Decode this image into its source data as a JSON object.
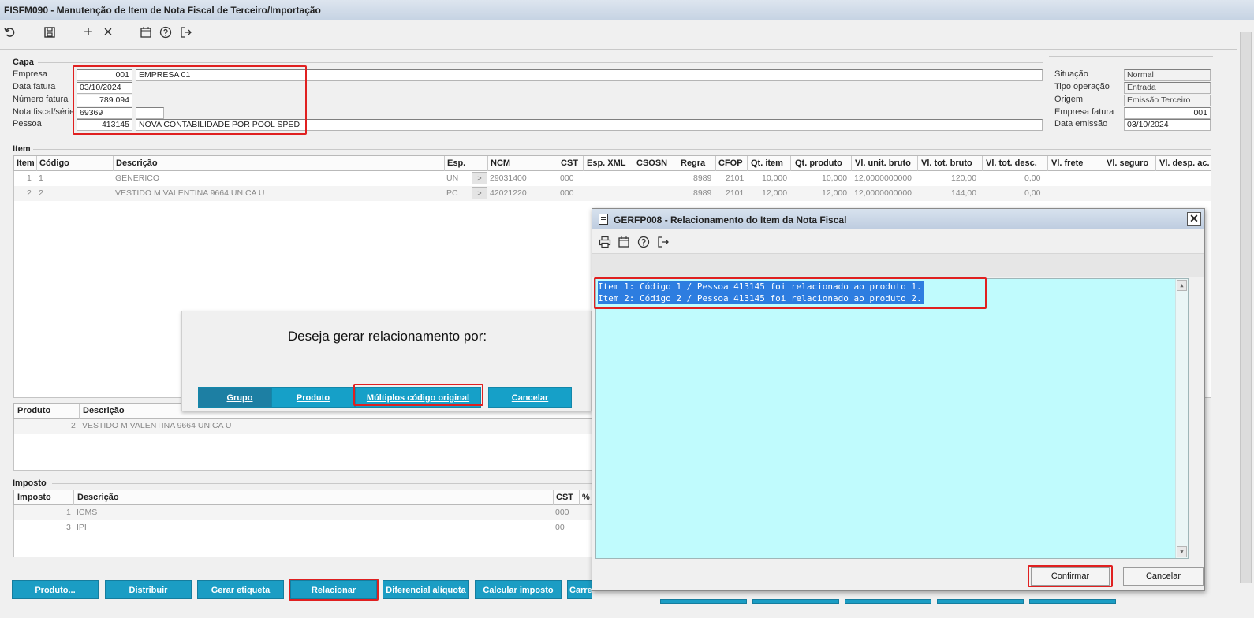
{
  "window": {
    "title": "FISFM090 - Manutenção de Item de Nota Fiscal de Terceiro/Importação"
  },
  "toolbar": {
    "icons": [
      "undo-icon",
      "save-icon",
      "add-icon",
      "delete-icon",
      "calendar-icon",
      "help-icon",
      "exit-icon"
    ],
    "add_glyph": "+",
    "delete_glyph": "×"
  },
  "capa": {
    "group_label": "Capa",
    "empresa_label": "Empresa",
    "empresa_code": "001",
    "empresa_name": "EMPRESA 01",
    "data_fatura_label": "Data fatura",
    "data_fatura": "03/10/2024",
    "numero_fatura_label": "Número fatura",
    "numero_fatura": "789.094",
    "nota_fiscal_label": "Nota fiscal/série",
    "nota_fiscal": "69369",
    "serie": "",
    "pessoa_label": "Pessoa",
    "pessoa_code": "413145",
    "pessoa_name": "NOVA CONTABILIDADE POR POOL SPED"
  },
  "side": {
    "situacao_label": "Situação",
    "situacao": "Normal",
    "tipo_operacao_label": "Tipo operação",
    "tipo_operacao": "Entrada",
    "origem_label": "Origem",
    "origem": "Emissão Terceiro",
    "empresa_fatura_label": "Empresa fatura",
    "empresa_fatura": "001",
    "data_emissao_label": "Data emissão",
    "data_emissao": "03/10/2024"
  },
  "item_grid": {
    "group_label": "Item",
    "columns": [
      "Item",
      "Código",
      "Descrição",
      "Esp.",
      "NCM",
      "CST",
      "Esp. XML",
      "CSOSN",
      "Regra",
      "CFOP",
      "Qt. item",
      "Qt. produto",
      "Vl. unit. bruto",
      "Vl. tot. bruto",
      "Vl. tot. desc.",
      "Vl. frete",
      "Vl. seguro",
      "Vl. desp. ac."
    ],
    "esp_button": ">",
    "rows": [
      {
        "item": "1",
        "codigo": "1",
        "descricao": "GENERICO",
        "esp": "UN",
        "ncm": "29031400",
        "cst": "000",
        "regra": "8989",
        "cfop": "2101",
        "qt_item": "10,000",
        "qt_produto": "10,000",
        "vl_unit": "12,0000000000",
        "vl_tot": "120,00",
        "vl_desc": "0,00"
      },
      {
        "item": "2",
        "codigo": "2",
        "descricao": "VESTIDO M VALENTINA 9664 UNICA U",
        "esp": "PC",
        "ncm": "42021220",
        "cst": "000",
        "regra": "8989",
        "cfop": "2101",
        "qt_item": "12,000",
        "qt_produto": "12,000",
        "vl_unit": "12,0000000000",
        "vl_tot": "144,00",
        "vl_desc": "0,00"
      }
    ]
  },
  "produto_grid": {
    "columns": [
      "Produto",
      "Descrição"
    ],
    "rows": [
      {
        "produto": "2",
        "descricao": "VESTIDO M VALENTINA 9664 UNICA U"
      }
    ]
  },
  "imposto_grid": {
    "group_label": "Imposto",
    "columns": [
      "Imposto",
      "Descrição",
      "CST",
      "%"
    ],
    "rows": [
      {
        "imposto": "1",
        "descricao": "ICMS",
        "cst": "000"
      },
      {
        "imposto": "3",
        "descricao": "IPI",
        "cst": "00"
      }
    ]
  },
  "bottom_buttons": [
    "Produto...",
    "Distribuir",
    "Gerar etiqueta",
    "Relacionar",
    "Diferencial alíquota",
    "Calcular imposto",
    "Carre"
  ],
  "ask_dialog": {
    "question": "Deseja gerar relacionamento por:",
    "buttons": [
      "Grupo",
      "Produto",
      "Múltiplos código original",
      "Cancelar"
    ]
  },
  "gerfp008": {
    "title": "GERFP008 - Relacionamento do Item da Nota Fiscal",
    "close_glyph": "✕",
    "toolbar_icons": [
      "print-icon",
      "calendar-icon",
      "help-icon",
      "exit-icon"
    ],
    "lines": [
      "Item 1: Código 1 / Pessoa 413145 foi relacionado ao produto 1.",
      "Item 2: Código 2 / Pessoa 413145 foi relacionado ao produto 2."
    ],
    "confirm_label": "Confirmar",
    "cancel_label": "Cancelar"
  },
  "colors": {
    "accent_button": "#1b9dc4",
    "log_background": "#c0fbfd",
    "highlight_box": "#e02020",
    "selection": "#2d7de0"
  }
}
